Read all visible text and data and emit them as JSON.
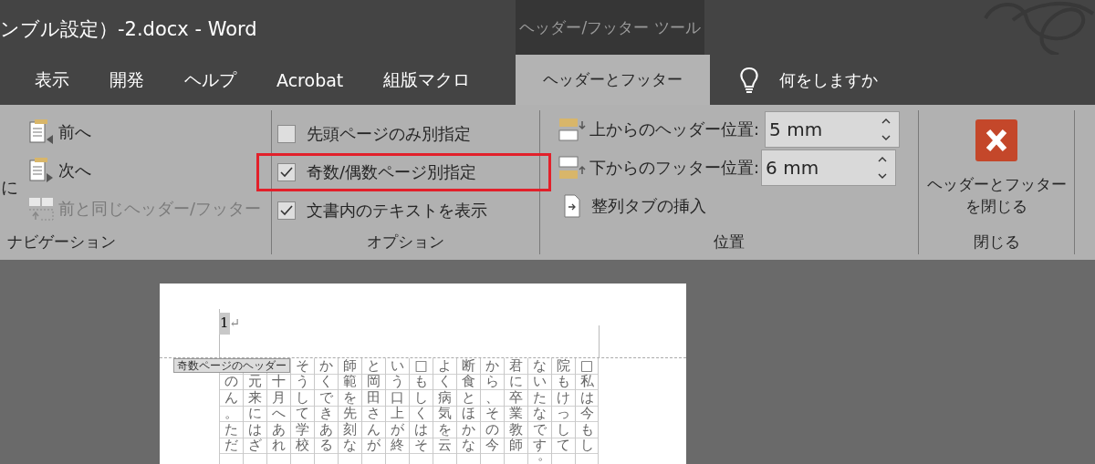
{
  "window": {
    "title": "ンブル設定）-2.docx  -  Word",
    "context_tab": "ヘッダー/フッター ツール"
  },
  "tabs": [
    {
      "label": "表示",
      "selected": false
    },
    {
      "label": "開発",
      "selected": false
    },
    {
      "label": "ヘルプ",
      "selected": false
    },
    {
      "label": "Acrobat",
      "selected": false
    },
    {
      "label": "組版マクロ",
      "selected": false
    },
    {
      "label": "ヘッダーとフッター",
      "selected": true
    }
  ],
  "tell_me": "何をしますか",
  "ribbon": {
    "navigation": {
      "cut_label": "に",
      "items": [
        {
          "label": "前へ",
          "disabled": false,
          "kind": "prev"
        },
        {
          "label": "次へ",
          "disabled": false,
          "kind": "next"
        },
        {
          "label": "前と同じヘッダー/フッター",
          "disabled": true,
          "kind": "link"
        }
      ],
      "group_label": "ナビゲーション"
    },
    "options": {
      "items": [
        {
          "label": "先頭ページのみ別指定",
          "checked": false,
          "highlighted": false
        },
        {
          "label": "奇数/偶数ページ別指定",
          "checked": true,
          "highlighted": true
        },
        {
          "label": "文書内のテキストを表示",
          "checked": true,
          "highlighted": false
        }
      ],
      "group_label": "オプション"
    },
    "position": {
      "fields": [
        {
          "label": "上からのヘッダー位置:",
          "value": "5 mm",
          "kind": "header"
        },
        {
          "label": "下からのフッター位置:",
          "value": "6 mm",
          "kind": "footer"
        }
      ],
      "button": "整列タブの挿入",
      "group_label": "位置"
    },
    "close": {
      "button_lines": [
        "ヘッダーとフッター",
        "を閉じる"
      ],
      "group_label": "閉じる"
    }
  },
  "document": {
    "header_text": "1",
    "paragraph_mark": "↵",
    "header_tag": "奇数ページのヘッダー",
    "columns": [
      [
        null,
        "の",
        "ん",
        "。",
        "た",
        "だ"
      ],
      [
        null,
        "元",
        "来",
        "に",
        "は",
        "ざ"
      ],
      [
        null,
        "十",
        "月",
        "へ",
        "あ",
        "れ"
      ],
      [
        "そ",
        "う",
        "し",
        "て",
        "学",
        "校"
      ],
      [
        "か",
        "く",
        "で",
        "き",
        "あ",
        "る"
      ],
      [
        "師",
        "範",
        "を",
        "先",
        "刻",
        "な"
      ],
      [
        "と",
        "岡",
        "田",
        "さ",
        "ん",
        "が"
      ],
      [
        "い",
        "う",
        "口",
        "上",
        "が",
        "終"
      ],
      [
        "□",
        "も",
        "し",
        "く",
        "は",
        "そ"
      ],
      [
        "よ",
        "く",
        "病",
        "気",
        "を",
        "云"
      ],
      [
        "断",
        "食",
        "と",
        "ほ",
        "か",
        "な"
      ],
      [
        "か",
        "ら",
        "、",
        "そ",
        "の",
        "今"
      ],
      [
        "君",
        "に",
        "卒",
        "業",
        "教",
        "師"
      ],
      [
        "な",
        "い",
        "た",
        "な",
        "で",
        "す",
        "。"
      ],
      [
        "院",
        "も",
        "け",
        "っ",
        "し",
        "て"
      ],
      [
        "□",
        "私",
        "は",
        "今",
        "も",
        "し"
      ]
    ]
  }
}
